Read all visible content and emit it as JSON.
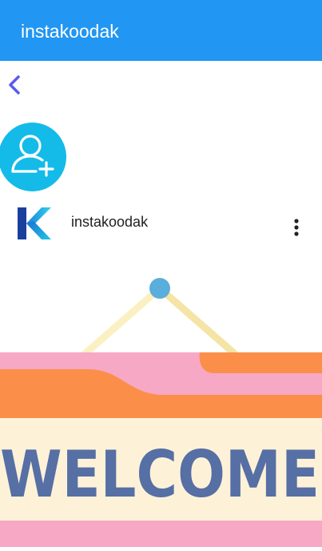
{
  "app": {
    "title": "instakoodak",
    "primary_color": "#2196f3"
  },
  "toolbar": {
    "back_icon": "chevron-left-icon",
    "back_color": "#5b5bf0"
  },
  "add_user": {
    "icon": "add-user-icon",
    "color": "#14bbe8"
  },
  "post": {
    "username": "instakoodak",
    "logo_icon": "k-logo-icon",
    "menu_icon": "more-vert-icon",
    "image": {
      "sign_text": "WELCOME",
      "colors": {
        "pink": "#f7a8c4",
        "orange": "#fb8f4a",
        "cream": "#fdf2d8",
        "text": "#566fa4",
        "nail": "#5aaedb"
      }
    }
  }
}
